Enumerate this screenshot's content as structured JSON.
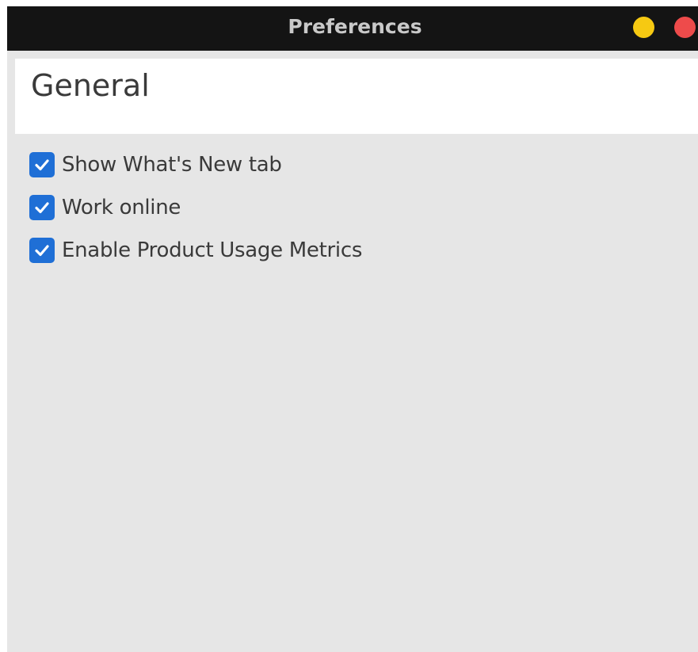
{
  "window": {
    "title": "Preferences",
    "controls": [
      "minimize",
      "close"
    ]
  },
  "section": {
    "title": "General"
  },
  "options": [
    {
      "label": "Show What's New tab",
      "checked": true
    },
    {
      "label": "Work online",
      "checked": true
    },
    {
      "label": "Enable Product Usage Metrics",
      "checked": true
    }
  ],
  "colors": {
    "titlebar": "#141414",
    "minimize": "#f6c912",
    "close": "#ee4b4b",
    "checkbox": "#1f6fd6",
    "background": "#e6e6e6"
  }
}
